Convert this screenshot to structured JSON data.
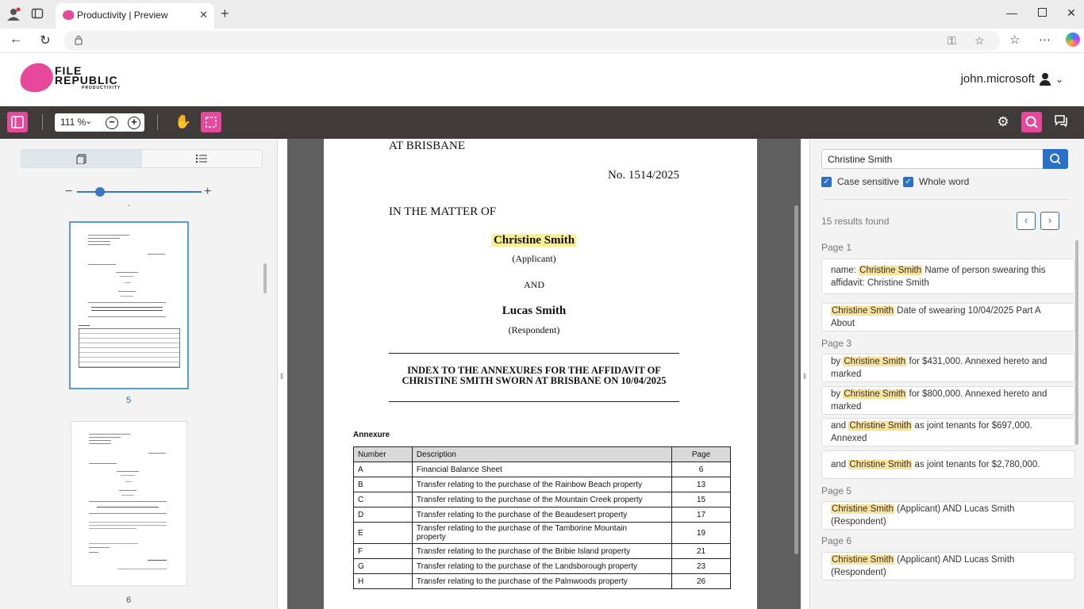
{
  "browser": {
    "tab_title": "Productivity | Preview",
    "new_tab": "+",
    "close": "✕"
  },
  "app": {
    "logo_line1": "FILE",
    "logo_line2": "REPUBLIC",
    "logo_line3": "PRODUCTIVITY",
    "username": "john.microsoft",
    "accent": "#e8489b"
  },
  "toolbar": {
    "zoom": "111 %"
  },
  "thumbnails": {
    "slider_label": "‚",
    "pages": [
      {
        "number": "5"
      },
      {
        "number": "6"
      }
    ]
  },
  "document": {
    "court_place": "AT BRISBANE",
    "case_number": "No. 1514/2025",
    "matter": "IN THE MATTER OF",
    "applicant_name": "Christine Smith",
    "applicant_role": "(Applicant)",
    "and": "AND",
    "respondent_name": "Lucas Smith",
    "respondent_role": "(Respondent)",
    "index_title_line1": "INDEX TO THE ANNEXURES FOR THE AFFIDAVIT OF",
    "index_title_line2": "CHRISTINE SMITH SWORN AT BRISBANE ON 10/04/2025",
    "annexure_heading": "Annexure",
    "table": {
      "headers": [
        "Number",
        "Description",
        "Page"
      ],
      "rows": [
        [
          "A",
          "Financial Balance Sheet",
          "6"
        ],
        [
          "B",
          "Transfer relating to the purchase of the Rainbow Beach property",
          "13"
        ],
        [
          "C",
          "Transfer relating to the purchase of the Mountain Creek property",
          "15"
        ],
        [
          "D",
          "Transfer relating to the purchase of the Beaudesert property",
          "17"
        ],
        [
          "E",
          "Transfer relating to the purchase of the Tamborine Mountain property",
          "19"
        ],
        [
          "F",
          "Transfer relating to the purchase of the Bribie Island property",
          "21"
        ],
        [
          "G",
          "Transfer relating to the purchase of the Landsborough property",
          "23"
        ],
        [
          "H",
          "Transfer relating to the purchase of the Palmwoods property",
          "26"
        ]
      ]
    }
  },
  "search": {
    "query": "Christine Smith",
    "case_sensitive": "Case sensitive",
    "whole_word": "Whole word",
    "results_count": "15 results found",
    "term": "Christine Smith",
    "groups": [
      {
        "page": "Page 1",
        "results": [
          {
            "before": "name: ",
            "after": " Name of person swearing this affidavit: Christine Smith"
          },
          {
            "before": "",
            "after": " Date of swearing 10/04/2025 Part A About"
          }
        ]
      },
      {
        "page": "Page 3",
        "results": [
          {
            "before": "by ",
            "after": " for $431,000. Annexed hereto and marked"
          },
          {
            "before": "by ",
            "after": " for $800,000. Annexed hereto and marked"
          },
          {
            "before": "and ",
            "after": " as joint tenants for $697,000. Annexed"
          },
          {
            "before": "and ",
            "after": " as joint tenants for $2,780,000."
          }
        ]
      },
      {
        "page": "Page 5",
        "results": [
          {
            "before": "",
            "after": " (Applicant) AND Lucas Smith (Respondent)"
          }
        ]
      },
      {
        "page": "Page 6",
        "results": [
          {
            "before": "",
            "after": " (Applicant) AND Lucas Smith (Respondent)"
          }
        ]
      }
    ]
  }
}
